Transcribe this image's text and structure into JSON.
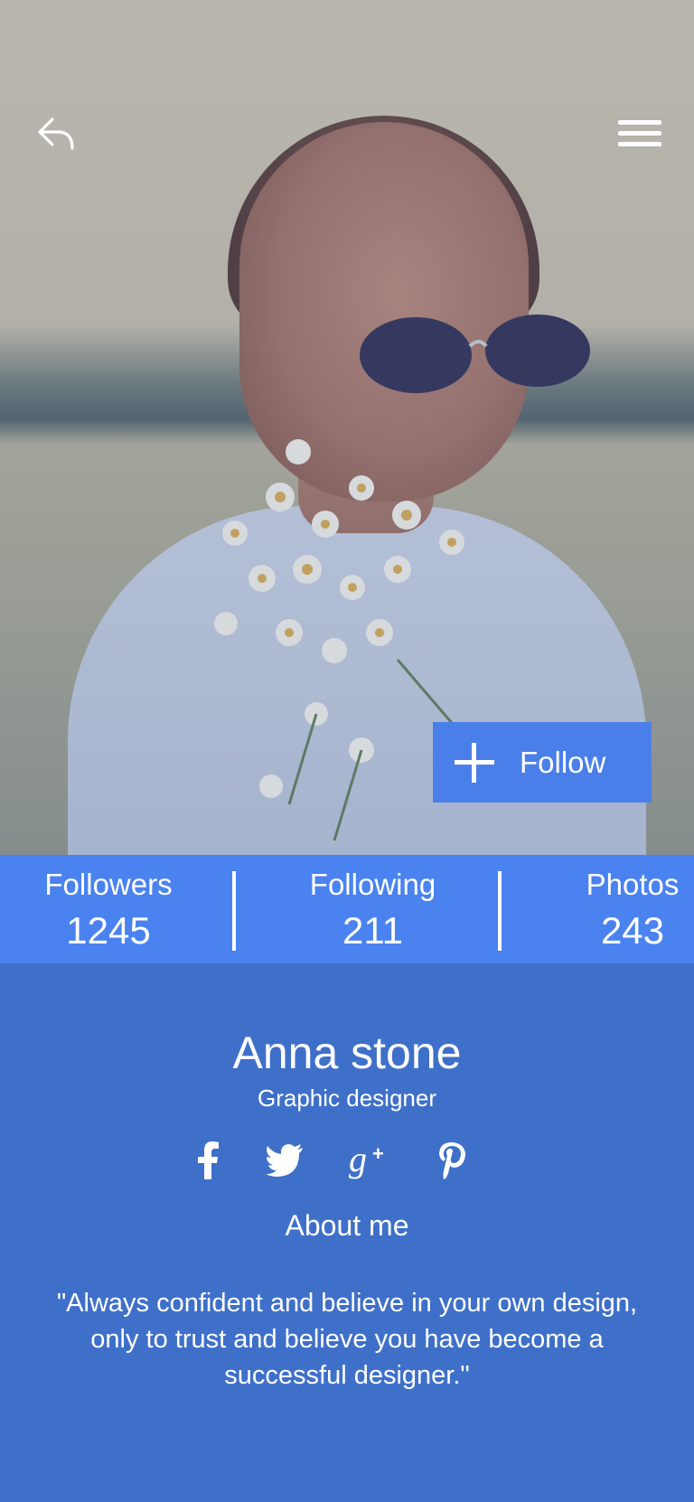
{
  "header": {
    "back_icon": "reply-arrow-icon",
    "menu_icon": "hamburger-menu-icon",
    "follow_label": "Follow",
    "follow_icon": "plus-icon"
  },
  "stats": [
    {
      "label": "Followers",
      "value": "1245"
    },
    {
      "label": "Following",
      "value": "211"
    },
    {
      "label": "Photos",
      "value": "243"
    }
  ],
  "profile": {
    "name": "Anna stone",
    "role": "Graphic designer",
    "socials": [
      "facebook-icon",
      "twitter-icon",
      "google-plus-icon",
      "pinterest-icon"
    ],
    "about_title": "About me",
    "about_text": "\"Always confident and believe in your own design, only to trust and believe you have become a successful designer.\""
  },
  "colors": {
    "accent": "#4a82f0",
    "panel": "#3f70c9",
    "button": "#4a7fe9"
  }
}
